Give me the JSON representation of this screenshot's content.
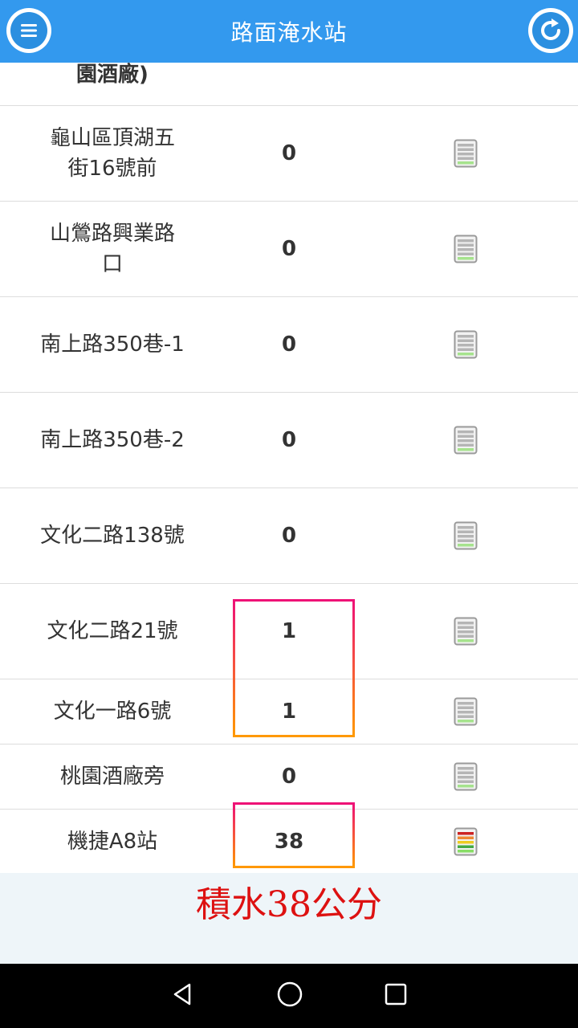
{
  "app": {
    "title": "路面淹水站"
  },
  "header": {
    "menu_icon": "menu-icon",
    "refresh_icon": "refresh-icon"
  },
  "partial_row": {
    "name": "園酒廠)"
  },
  "stations": [
    {
      "name": "龜山區頂湖五街16號前",
      "value": "0",
      "level": 0
    },
    {
      "name": "山鶯路興業路口",
      "value": "0",
      "level": 0
    },
    {
      "name": "南上路350巷-1",
      "value": "0",
      "level": 0
    },
    {
      "name": "南上路350巷-2",
      "value": "0",
      "level": 0
    },
    {
      "name": "文化二路138號",
      "value": "0",
      "level": 0
    },
    {
      "name": "文化二路21號",
      "value": "1",
      "level": 0
    },
    {
      "name": "文化一路6號",
      "value": "1",
      "level": 0
    },
    {
      "name": "桃園酒廠旁",
      "value": "0",
      "level": 0
    },
    {
      "name": "機捷A8站",
      "value": "38",
      "level": 4
    }
  ],
  "annotation": "積水38公分",
  "colors": {
    "appbar": "#3399ee",
    "annotation": "#dd1111",
    "highlight_top": "#ee1177",
    "highlight_bottom": "#ff9900"
  },
  "navbar": {
    "back_icon": "back-icon",
    "home_icon": "home-icon",
    "recents_icon": "recents-icon"
  }
}
